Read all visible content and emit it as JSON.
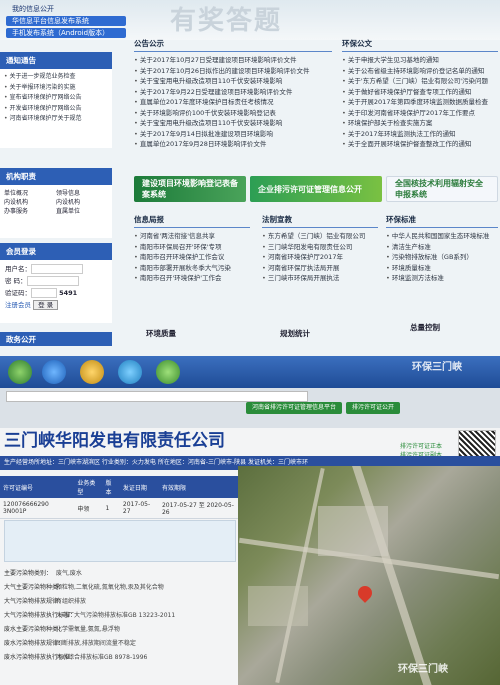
{
  "screen1": {
    "top_nav": [
      "我的信息公开",
      "华信息平台信息发布系统",
      "手机发布系统（Android版本）"
    ],
    "banner_title": "有奖答题",
    "notice_title": "通知通告",
    "notice_items": [
      "关于进一步规范业务检查",
      "关于举报环境污染的实施",
      "宣布省环境保护厅网络公告",
      "开发省环境保护厅网络公告",
      "河南省环境保护厅关于规范"
    ],
    "duty_title": "机构职责",
    "duty_items": [
      "单位概况",
      "领导信息",
      "内设机构",
      "内设机构",
      "办事服务",
      "直属单位"
    ],
    "member_title": "会员登录",
    "login_user_label": "用户名：",
    "login_pass_label": "密 码：",
    "login_code_label": "验证码：",
    "login_code_value": "5491",
    "login_register": "注册会员",
    "login_button": "登 录",
    "gov_open": "政务公开",
    "announce_title": "公告公示",
    "announce_items": [
      "关于2017年10月27日受理建设项目环境影响评价文件",
      "关于2017年10月26日拟作出的建设项目环境影响评价文件",
      "关于宝宝用电升级改造项目110千伏安装环境影响",
      "关于2017年9月22日受理建设项目环境影响评价文件",
      "直属单位2017年度环境保护目标责任考核情况",
      "关于环境影响评价100千伏安装环境影响登记表",
      "关于宝宝用电升级改造项目110千伏安装环境影响",
      "关于2017年9月14日拟批准建设项目环境影响",
      "直属单位2017年9月28日环境影响评价文件"
    ],
    "env_title": "环保公文",
    "env_items": [
      "关于申报大学生见习基地的通知",
      "关于公布省级主持环境影响评价登记名单的通知",
      "关于'东方希望（三门峡）铝业有限公司'污染问题",
      "关于做好省环境保护厅督查专项工作的通知",
      "关于开展2017年第四季度环境监测数据质量检查",
      "关于印发河南省环境保护厅2017年工作要点",
      "环境保护部关于检查实施方案",
      "关于2017年环境监测执法工作的通知",
      "关于全面开展环境保护督查整改工作的通知"
    ],
    "ad1": "建设项目环境影响登记表备案系统",
    "ad2": "企业排污许可证管理信息公开",
    "ad3": "全国核技术利用辐射安全申报系统",
    "info_title": "信息局报",
    "info_items": [
      "河南省'两法衔接'信息共享",
      "南阳市环保局召开'环保'专项",
      "南阳市召开环境保护工作会议",
      "南阳市部署开展秋冬季大气污染",
      "南阳市召开'环境保护'工作会"
    ],
    "law_title": "法制宣教",
    "law_items": [
      "东方希望（三门峡）铝业有限公司",
      "三门峡华阳发电有限责任公司",
      "河南省环境保护厅2017年",
      "河南省环保厅执法局开展",
      "三门峡市环保局开展执法"
    ],
    "standard_title": "环保标准",
    "standard_items": [
      "中华人民共和国国家生态环境标准",
      "清洁生产标准",
      "污染物排放标准（GB系列）",
      "环境质量标准",
      "环境监测方法标准"
    ],
    "bottom_titles": [
      "环境质量",
      "规划统计",
      "总量控制"
    ],
    "watermark": "环保三门峡"
  },
  "screen2": {
    "browser_tabs": [
      "河南省排污许可证管理信息平台",
      "排污许可证公开"
    ],
    "company_name": "三门峡华阳发电有限责任公司",
    "meta": "生产经营场所地址：三门峡市湖滨区  行业类别：火力发电  所在地区：河南省-三门峡市-陕县  发证机关：三门峡市环",
    "license_links": [
      "排污许可证正本",
      "排污许可证副本"
    ],
    "table_headers": [
      "许可证编号",
      "业务类型",
      "版本",
      "发证日期",
      "有效期限"
    ],
    "table_row": [
      "120076666290 3N001P",
      "申领",
      "1",
      "2017-05-27",
      "2017-05-27 至 2020-05-26"
    ],
    "form": [
      {
        "k": "主要污染物类别：",
        "v": "废气,废水"
      },
      {
        "k": "大气主要污染物种类：",
        "v": "颗粒物,二氧化硫,氮氧化物,汞及其化合物"
      },
      {
        "k": "大气污染物排放规律：",
        "v": "有组织排放"
      },
      {
        "k": "大气污染物排放执行标准：",
        "v": "火电厂大气污染物排放标准GB 13223-2011"
      },
      {
        "k": "废水主要污染物种类：",
        "v": "化学需氧量,氨氮,悬浮物"
      },
      {
        "k": "废水污染物排放规律：",
        "v": "间断排放,排放期间流量不稳定"
      },
      {
        "k": "废水污染物排放执行标准：",
        "v": "污水综合排放标准GB 8978-1996"
      }
    ],
    "watermark": "环保三门峡"
  }
}
